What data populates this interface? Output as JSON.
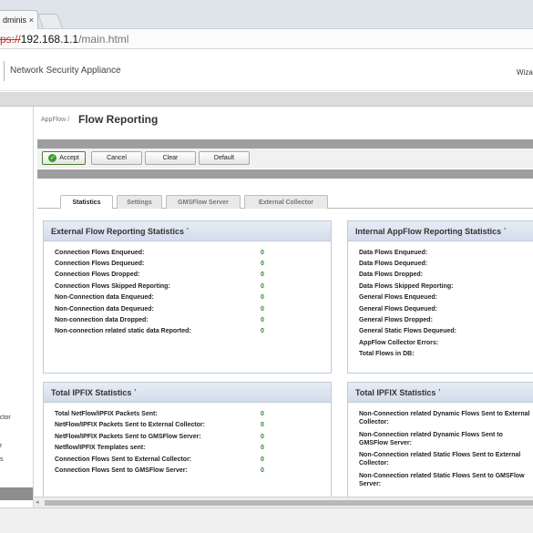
{
  "browser": {
    "tab_title": "dminis",
    "tab_close": "×",
    "url_scheme": "ps://",
    "url_host": "192.168.1.1",
    "url_path": "/main.html"
  },
  "header": {
    "title": "Network Security Appliance",
    "wizard_label": "Wiza"
  },
  "leftnav": {
    "items": [
      "ctor",
      "r",
      "s"
    ]
  },
  "page": {
    "breadcrumb": "AppFlow /",
    "title": "Flow Reporting"
  },
  "toolbar": {
    "accept": "Accept",
    "cancel": "Cancel",
    "clear": "Clear",
    "default": "Default"
  },
  "tabs": [
    "Statistics",
    "Settings",
    "GMSFlow Server",
    "External Collector"
  ],
  "panels": {
    "external": {
      "title": "External Flow Reporting Statistics",
      "tick": "‛",
      "rows": [
        {
          "label": "Connection Flows Enqueued:",
          "value": "0"
        },
        {
          "label": "Connection Flows Dequeued:",
          "value": "0"
        },
        {
          "label": "Connection Flows Dropped:",
          "value": "0"
        },
        {
          "label": "Connection Flows Skipped Reporting:",
          "value": "0"
        },
        {
          "label": "Non-Connection data Enqueued:",
          "value": "0"
        },
        {
          "label": "Non-Connection data Dequeued:",
          "value": "0"
        },
        {
          "label": "Non-connection data Dropped:",
          "value": "0"
        },
        {
          "label": "Non-connection related static data Reported:",
          "value": "0"
        }
      ]
    },
    "internal": {
      "title": "Internal AppFlow Reporting Statistics",
      "tick": "‛",
      "rows": [
        {
          "label": "Data Flows Enqueued:"
        },
        {
          "label": "Data Flows Dequeued:"
        },
        {
          "label": "Data Flows Dropped:"
        },
        {
          "label": "Data Flows Skipped Reporting:"
        },
        {
          "label": "General Flows Enqueued:"
        },
        {
          "label": "General Flows Dequeued:"
        },
        {
          "label": "General Flows Dropped:"
        },
        {
          "label": "General Static Flows Dequeued:"
        },
        {
          "label": "AppFlow Collector Errors:"
        },
        {
          "label": "Total Flows in DB:"
        }
      ]
    },
    "ipfix_left": {
      "title": "Total IPFIX Statistics",
      "tick": "‛",
      "rows": [
        {
          "label": "Total NetFlow/IPFIX Packets Sent:",
          "value": "0"
        },
        {
          "label": "NetFlow/IPFIX Packets Sent to External Collector:",
          "value": "0"
        },
        {
          "label": "NetFlow/IPFIX Packets Sent to GMSFlow Server:",
          "value": "0"
        },
        {
          "label": "Netflow/IPFIX Templates sent:",
          "value": "0"
        },
        {
          "label": "Connection Flows Sent to External Collector:",
          "value": "0"
        },
        {
          "label": "Connection Flows Sent to GMSFlow Server:",
          "value": "0"
        }
      ]
    },
    "ipfix_right": {
      "title": "Total IPFIX Statistics",
      "tick": "‛",
      "rows": [
        {
          "label": "Non-Connection related Dynamic Flows Sent to External Collector:"
        },
        {
          "label": "Non-Connection related Dynamic Flows Sent to GMSFlow Server:"
        },
        {
          "label": "Non-Connection related Static Flows Sent to External Collector:"
        },
        {
          "label": "Non-Connection related Static Flows Sent to GMSFlow Server:"
        }
      ]
    }
  }
}
